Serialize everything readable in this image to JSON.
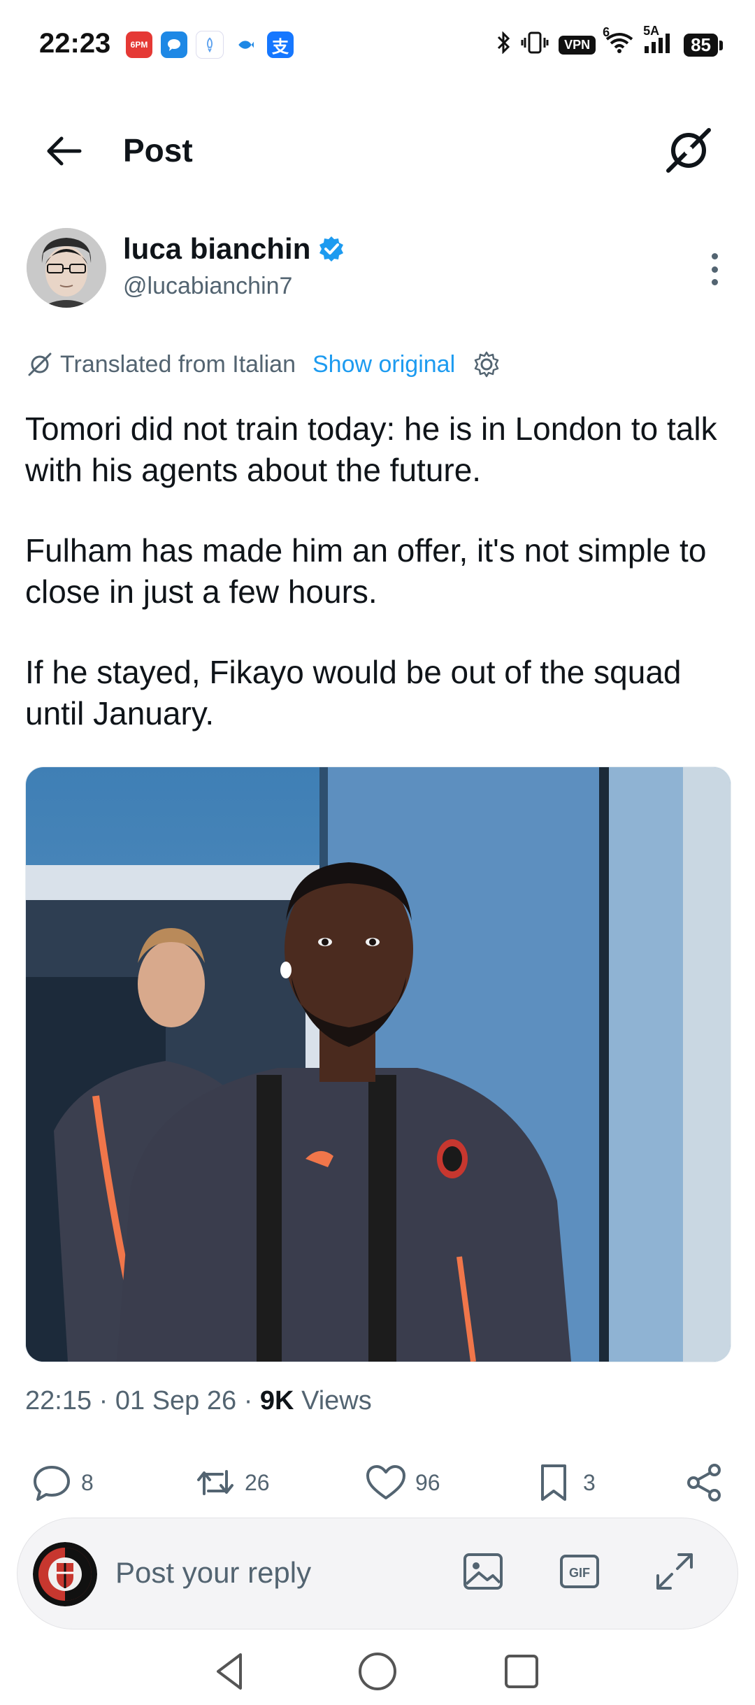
{
  "status_bar": {
    "time": "22:23",
    "notification_icons": [
      "6pm-app-icon",
      "chat-bubble-icon",
      "rocket-icon",
      "fish-app-icon",
      "alipay-icon"
    ],
    "network_label": "5A",
    "signal_superscript": "6",
    "vpn_label": "VPN",
    "battery": "85"
  },
  "header": {
    "title": "Post"
  },
  "author": {
    "name": "luca bianchin",
    "handle": "@lucabianchin7",
    "verified": true
  },
  "translation": {
    "label": "Translated from Italian",
    "show_original": "Show original"
  },
  "post": {
    "paragraphs": [
      "Tomori did not train today: he is in London to talk with his agents about the future.",
      "Fulham has made him an offer, it's not simple to close in just a few hours.",
      "If he stayed, Fikayo would be out of the squad until January."
    ]
  },
  "meta": {
    "time": "22:15",
    "separator": " · ",
    "date": "01 Sep 26",
    "views_count": "9K",
    "views_label": "Views"
  },
  "actions": {
    "replies": "8",
    "reposts": "26",
    "likes": "96",
    "bookmarks": "3"
  },
  "reply": {
    "placeholder": "Post your reply"
  },
  "colors": {
    "accent": "#1d9bf0",
    "text_primary": "#0f1419",
    "text_secondary": "#536471"
  }
}
